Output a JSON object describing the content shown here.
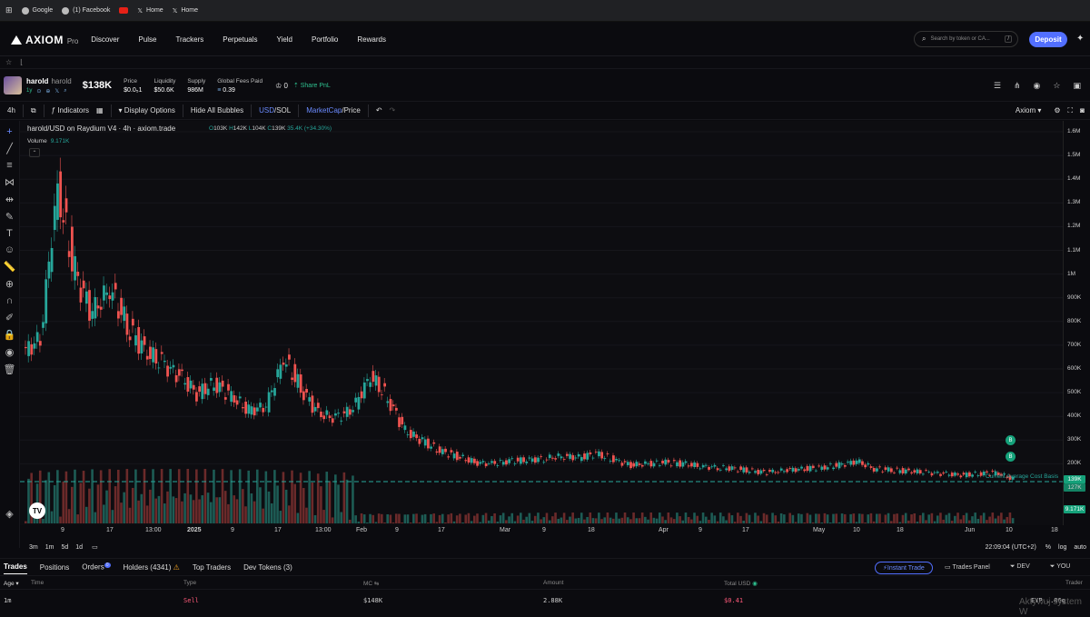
{
  "bookmarks": [
    {
      "label": "Google",
      "icon": "globe-icon"
    },
    {
      "label": "(1) Facebook",
      "icon": "globe-icon"
    },
    {
      "label": "",
      "icon": "youtube-icon"
    },
    {
      "label": "Home",
      "icon": "x-icon"
    },
    {
      "label": "Home",
      "icon": "x-icon"
    }
  ],
  "nav": {
    "brand": "AXIOM",
    "brand_suffix": "Pro",
    "links": [
      "Discover",
      "Pulse",
      "Trackers",
      "Perpetuals",
      "Yield",
      "Portfolio",
      "Rewards"
    ],
    "search_placeholder": "Search by token or CA...",
    "search_shortcut": "/",
    "deposit": "Deposit"
  },
  "token": {
    "symbol": "harold",
    "name": "harold",
    "age": "1y",
    "market_cap": "$138K",
    "stats": [
      {
        "label": "Price",
        "value": "$0.0₅1"
      },
      {
        "label": "Liquidity",
        "value": "$50.6K"
      },
      {
        "label": "Supply",
        "value": "986M"
      },
      {
        "label": "Global Fees Paid",
        "value": "0.39"
      }
    ],
    "holders_crown": "0",
    "share": "Share PnL"
  },
  "toolbar": {
    "interval": "4h",
    "indicators": "Indicators",
    "display_options": "Display Options",
    "hide_bubbles": "Hide All Bubbles",
    "currency_a": "USD",
    "currency_b": "SOL",
    "mode_a": "MarketCap",
    "mode_b": "Price",
    "theme": "Axiom"
  },
  "chart": {
    "title": "harold/USD on Raydium V4 · 4h · axiom.trade",
    "ohlc": {
      "o": "103K",
      "h": "142K",
      "l": "104K",
      "c": "139K",
      "chg": "35.4K (+34.30%)"
    },
    "volume_label": "Volume",
    "volume_value": "9.171K",
    "avg_cost_label": "Current Average Cost Basis",
    "price_labels": {
      "last": "139K",
      "avg": "127K",
      "vol": "9.171K"
    },
    "bubble_label": "B",
    "time": "22:09:04 (UTC+2)",
    "scale_opts": [
      "%",
      "log",
      "auto"
    ],
    "ranges": [
      "3m",
      "1m",
      "5d",
      "1d"
    ]
  },
  "chart_data": {
    "type": "line",
    "series": [
      {
        "values": [
          640000,
          700000,
          1300000,
          950000,
          800000,
          900000,
          750000,
          650000,
          600000,
          550000,
          480000,
          520000,
          470000,
          410000,
          430000,
          620000,
          500000,
          400000,
          380000,
          420000,
          550000,
          460000,
          330000,
          290000,
          250000,
          230000,
          205000,
          200000,
          210000,
          215000,
          220000,
          230000,
          225000,
          240000,
          215000,
          195000,
          200000,
          205000,
          200000,
          190000,
          185000,
          180000,
          170000,
          165000,
          175000,
          180000,
          185000,
          195000,
          210000,
          180000,
          175000,
          170000,
          165000,
          160000,
          155000,
          160000,
          165000,
          139000
        ]
      }
    ],
    "y_ticks": [
      "1.6M",
      "1.5M",
      "1.4M",
      "1.3M",
      "1.2M",
      "1.1M",
      "1M",
      "900K",
      "800K",
      "700K",
      "600K",
      "500K",
      "400K",
      "300K",
      "200K"
    ],
    "x_ticks": [
      "9",
      "17",
      "13:00",
      "2025",
      "9",
      "17",
      "13:00",
      "Feb",
      "9",
      "17",
      "Mar",
      "9",
      "18",
      "Apr",
      "9",
      "17",
      "May",
      "10",
      "18",
      "Jun",
      "10",
      "18"
    ],
    "ylim": [
      100000,
      1650000
    ]
  },
  "bottom": {
    "tabs": [
      "Trades",
      "Positions",
      "Orders",
      "Holders (4341)",
      "Top Traders",
      "Dev Tokens (3)"
    ],
    "orders_badge": "0",
    "instant_trade": "Instant Trade",
    "trades_panel": "Trades Panel",
    "dev": "DEV",
    "you": "YOU",
    "columns": [
      "Age",
      "Time",
      "Type",
      "MC",
      "Amount",
      "Total USD",
      "Trader"
    ],
    "rows": [
      {
        "age": "1m",
        "type": "Sell",
        "mc": "$148K",
        "amount": "2.88K",
        "total": "$0.41",
        "trader": "EYP...86g"
      }
    ]
  },
  "overlay_text": "Aktywuj system W"
}
